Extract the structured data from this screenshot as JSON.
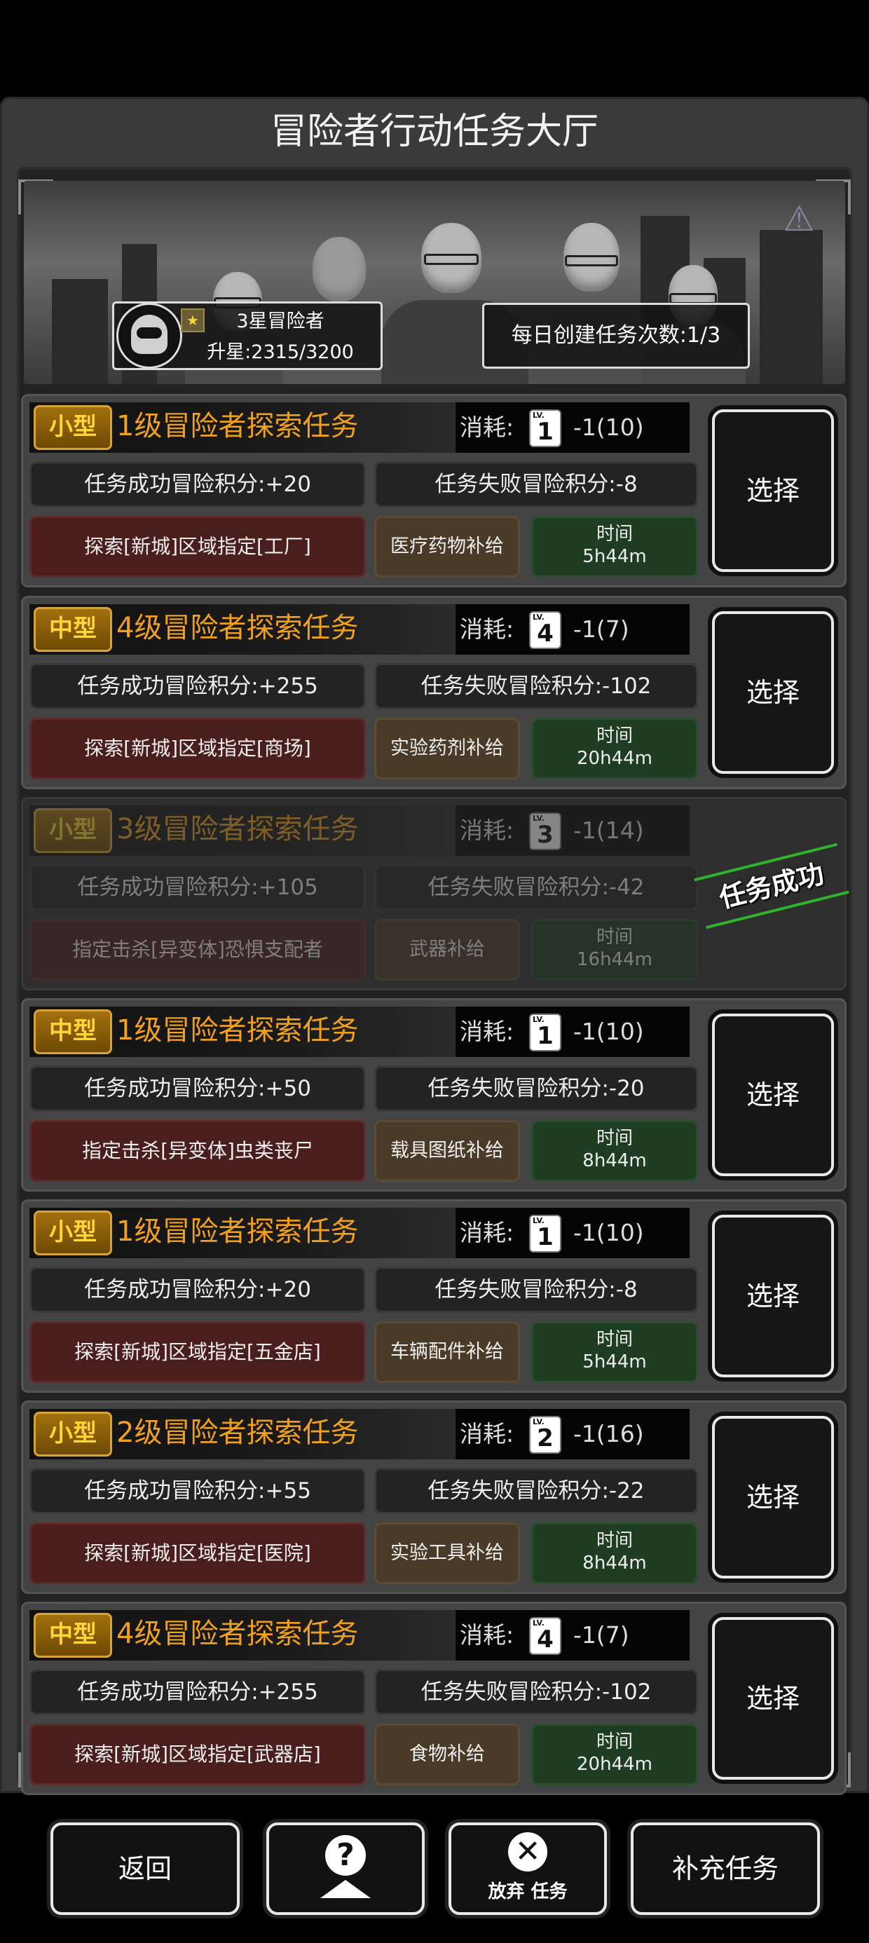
{
  "title": "冒险者行动任务大厅",
  "rank": {
    "name": "3星冒险者",
    "progress": "升星:2315/3200",
    "star_icon": "★"
  },
  "daily": "每日创建任务次数:1/3",
  "cost_label": "消耗:",
  "select_label": "选择",
  "success_label": "任务成功",
  "time_label": "时间",
  "tasks": [
    {
      "size": "小型",
      "title": "1级冒险者探索任务",
      "level": "1",
      "cost": "-1(10)",
      "success_pts": "任务成功冒险积分:+20",
      "fail_pts": "任务失败冒险积分:-8",
      "target": "探索[新城]区域指定[工厂]",
      "supply": "医疗药物补给",
      "time": "5h44m",
      "status": "available"
    },
    {
      "size": "中型",
      "title": "4级冒险者探索任务",
      "level": "4",
      "cost": "-1(7)",
      "success_pts": "任务成功冒险积分:+255",
      "fail_pts": "任务失败冒险积分:-102",
      "target": "探索[新城]区域指定[商场]",
      "supply": "实验药剂补给",
      "time": "20h44m",
      "status": "available"
    },
    {
      "size": "小型",
      "title": "3级冒险者探索任务",
      "level": "3",
      "cost": "-1(14)",
      "success_pts": "任务成功冒险积分:+105",
      "fail_pts": "任务失败冒险积分:-42",
      "target": "指定击杀[异变体]恐惧支配者",
      "supply": "武器补给",
      "time": "16h44m",
      "status": "completed"
    },
    {
      "size": "中型",
      "title": "1级冒险者探索任务",
      "level": "1",
      "cost": "-1(10)",
      "success_pts": "任务成功冒险积分:+50",
      "fail_pts": "任务失败冒险积分:-20",
      "target": "指定击杀[异变体]虫类丧尸",
      "supply": "载具图纸补给",
      "time": "8h44m",
      "status": "available"
    },
    {
      "size": "小型",
      "title": "1级冒险者探索任务",
      "level": "1",
      "cost": "-1(10)",
      "success_pts": "任务成功冒险积分:+20",
      "fail_pts": "任务失败冒险积分:-8",
      "target": "探索[新城]区域指定[五金店]",
      "supply": "车辆配件补给",
      "time": "5h44m",
      "status": "available"
    },
    {
      "size": "小型",
      "title": "2级冒险者探索任务",
      "level": "2",
      "cost": "-1(16)",
      "success_pts": "任务成功冒险积分:+55",
      "fail_pts": "任务失败冒险积分:-22",
      "target": "探索[新城]区域指定[医院]",
      "supply": "实验工具补给",
      "time": "8h44m",
      "status": "available"
    },
    {
      "size": "中型",
      "title": "4级冒险者探索任务",
      "level": "4",
      "cost": "-1(7)",
      "success_pts": "任务成功冒险积分:+255",
      "fail_pts": "任务失败冒险积分:-102",
      "target": "探索[新城]区域指定[武器店]",
      "supply": "食物补给",
      "time": "20h44m",
      "status": "available"
    }
  ],
  "bottom": {
    "back": "返回",
    "help_icon": "?",
    "abandon_icon": "✕",
    "abandon": "放弃 任务",
    "refill": "补充任务"
  }
}
